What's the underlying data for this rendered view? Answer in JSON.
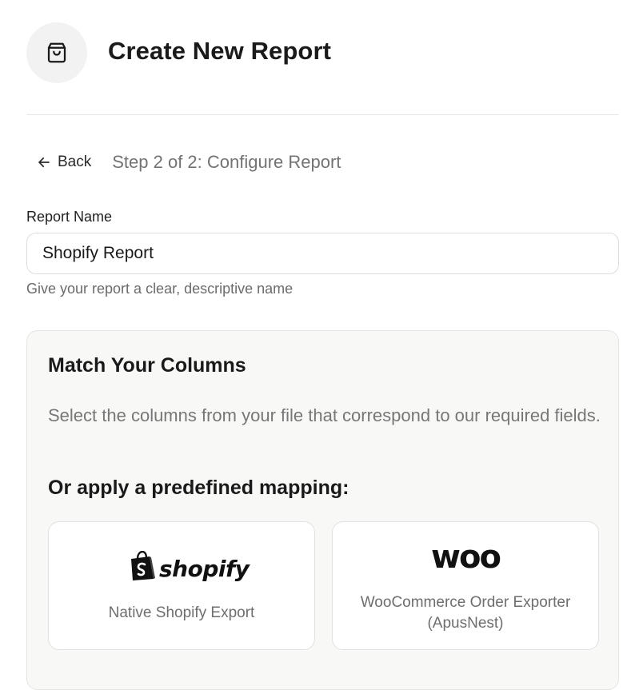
{
  "header": {
    "icon": "shopping-bag-icon",
    "title": "Create New Report"
  },
  "nav": {
    "back_label": "Back",
    "back_icon": "arrow-left-icon",
    "step_label": "Step 2 of 2: Configure Report"
  },
  "form": {
    "report_name_label": "Report Name",
    "report_name_value": "Shopify Report",
    "report_name_help": "Give your report a clear, descriptive name"
  },
  "mapping": {
    "title": "Match Your Columns",
    "description": "Select the columns from your file that correspond to our required fields.",
    "predefined_title": "Or apply a predefined mapping:",
    "options": [
      {
        "logo_text": "shopify",
        "logo_icon": "shopify-bag-icon",
        "label": "Native Shopify Export"
      },
      {
        "logo_text": "woo",
        "label_line1": "WooCommerce Order Exporter",
        "label_line2": "(ApusNest)"
      }
    ]
  }
}
